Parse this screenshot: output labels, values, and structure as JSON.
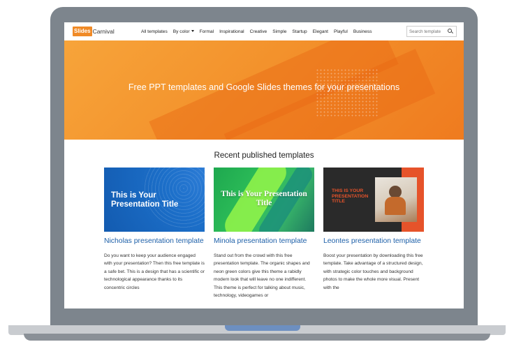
{
  "header": {
    "logo_box": "Slides",
    "logo_text": "Carnival",
    "nav": [
      "All templates",
      "By color",
      "Formal",
      "Inspirational",
      "Creative",
      "Simple",
      "Startup",
      "Elegant",
      "Playful",
      "Business"
    ],
    "search_placeholder": "Search template"
  },
  "hero": {
    "title": "Free PPT templates and Google Slides themes for your presentations"
  },
  "section": {
    "title": "Recent published templates"
  },
  "cards": [
    {
      "thumb_title": "This is Your Presentation Title",
      "title": "Nicholas presentation template",
      "desc": "Do you want to keep your audience engaged with your presentation? Then this free template is a safe bet. This is a design that has a scientific or technological appearance thanks to its concentric circles"
    },
    {
      "thumb_title": "This is Your Presentation Title",
      "title": "Minola presentation template",
      "desc": "Stand out from the crowd with this free presentation template. The organic shapes and neon green colors give this theme a rabidly modern look that will leave no one indifferent. This theme is perfect for talking about music, technology, videogames or"
    },
    {
      "thumb_title": "THIS IS YOUR PRESENTATION TITLE",
      "title": "Leontes presentation template",
      "desc": "Boost your presentation by downloading this free template. Take advantage of a structured design, with strategic color touches and background photos to make the whole more visual. Present with the"
    }
  ]
}
